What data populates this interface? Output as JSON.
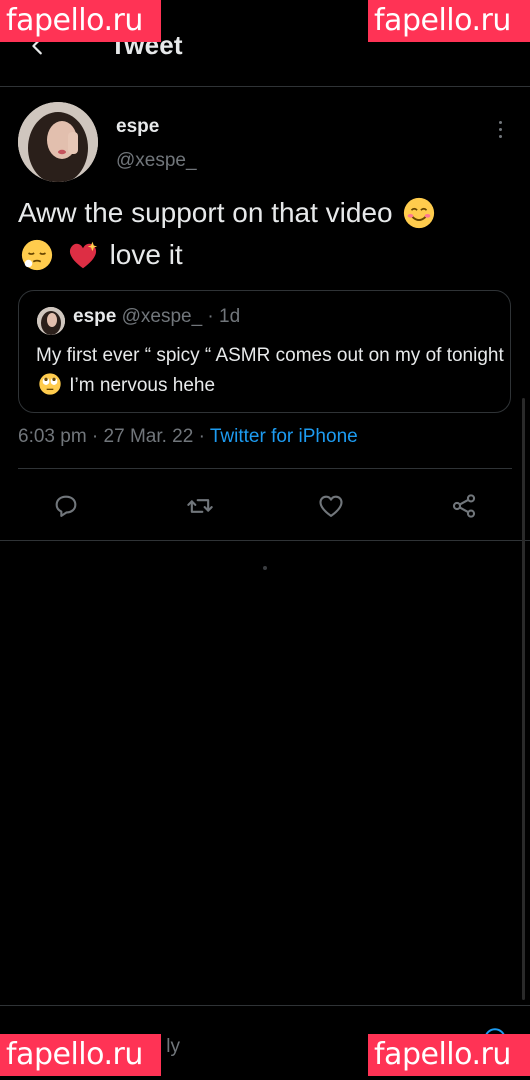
{
  "header": {
    "title": "Tweet",
    "back_icon": "arrow-left-icon"
  },
  "tweet": {
    "author_name": "espe",
    "author_handle": "@xespe_",
    "text_part1": "Aww the support on that video",
    "text_part2": "love it",
    "emojis": [
      "smiling-face-emoji",
      "relieved-face-emoji",
      "sparkling-heart-emoji"
    ],
    "timestamp": "6:03 pm · 27 Mar. 22 · ",
    "source": "Twitter for iPhone"
  },
  "quoted_tweet": {
    "author_name": "espe",
    "author_handle": "@xespe_",
    "age": " · 1d",
    "text_part1": "My first ever “ spicy “ ASMR comes out on my of tonight",
    "text_part2": "I’m nervous hehe",
    "emoji": "rolling-eyes-emoji"
  },
  "actions": [
    "reply-icon",
    "retweet-icon",
    "like-icon",
    "share-icon"
  ],
  "reply_bar": {
    "placeholder_visible": "ly"
  },
  "watermark": {
    "text": "fapello.ru",
    "color": "#ff3355"
  },
  "colors": {
    "background": "#000000",
    "text": "#e7e9ea",
    "muted": "#71767b",
    "accent": "#1d9bf0",
    "divider": "#2f3336"
  }
}
